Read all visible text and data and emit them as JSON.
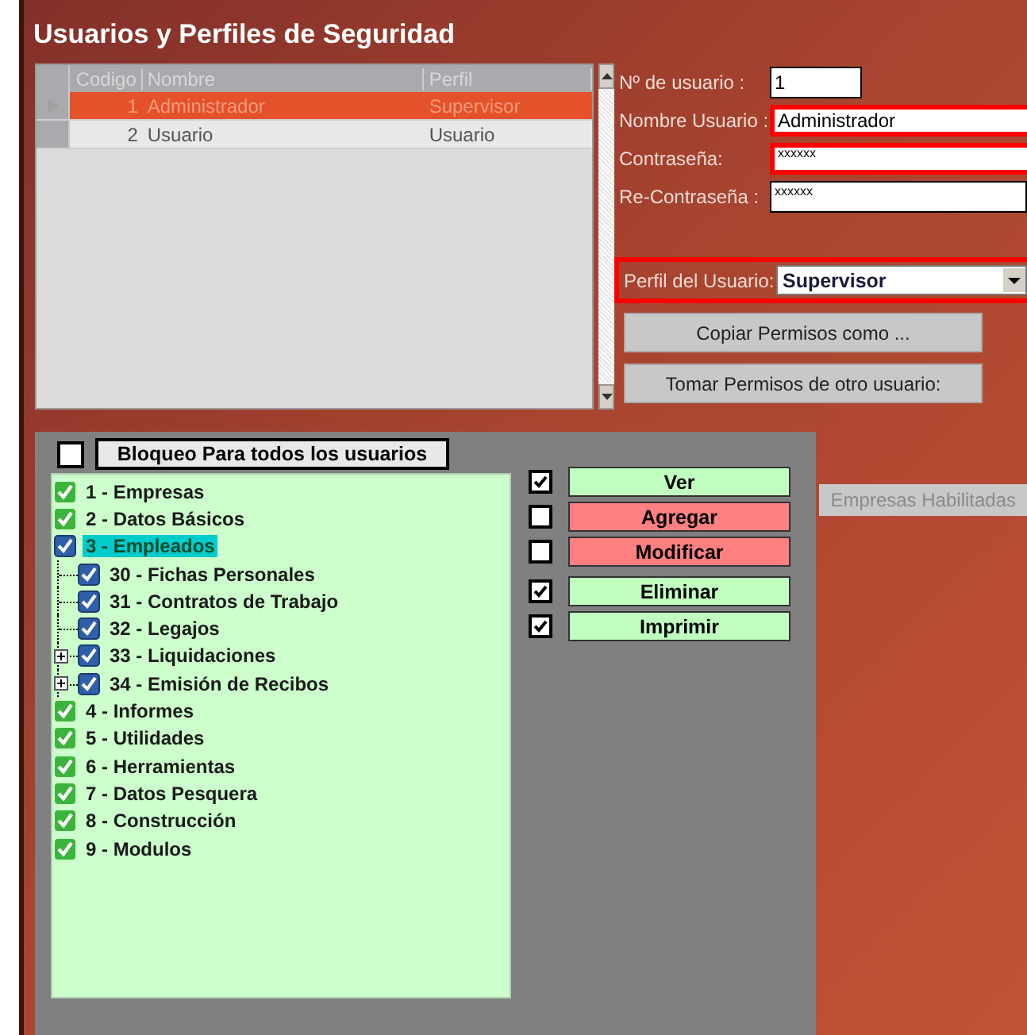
{
  "window": {
    "title": "Usuarios y Perfiles de Seguridad"
  },
  "users_table": {
    "columns": [
      "Codigo",
      "Nombre",
      "Perfil"
    ],
    "rows": [
      {
        "cells": [
          "1",
          "Administrador",
          "Supervisor"
        ],
        "selected": true
      },
      {
        "cells": [
          "2",
          "Usuario",
          "Usuario"
        ],
        "selected": false
      }
    ]
  },
  "fields": [
    {
      "label": "Nº de usuario :",
      "value": "1",
      "kind": "short",
      "highlighted": false
    },
    {
      "label": "Nombre Usuario :",
      "value": "Administrador",
      "kind": "text",
      "highlighted": true
    },
    {
      "label": "Contraseña:",
      "value": "xxxxxx",
      "kind": "password",
      "highlighted": true
    },
    {
      "label": "Re-Contraseña :",
      "value": "xxxxxx",
      "kind": "password",
      "highlighted": false
    }
  ],
  "profile": {
    "label": "Perfil del Usuario:",
    "value": "Supervisor",
    "highlighted": true
  },
  "action_buttons": [
    "Copiar Permisos como ...",
    "Tomar Permisos de otro usuario:"
  ],
  "block_all": {
    "label": "Bloqueo Para todos los usuarios",
    "checked": false
  },
  "tree": [
    {
      "label": "1 - Empresas",
      "checked": true,
      "selected": false
    },
    {
      "label": "2 - Datos Básicos",
      "checked": true,
      "selected": false
    },
    {
      "label": "3 - Empleados",
      "checked": true,
      "selected": true,
      "children": [
        {
          "label": "30 - Fichas Personales",
          "checked": true,
          "selected": false,
          "collapsed": false
        },
        {
          "label": "31 - Contratos de Trabajo",
          "checked": true,
          "selected": false,
          "collapsed": false
        },
        {
          "label": "32 - Legajos",
          "checked": true,
          "selected": false,
          "collapsed": false
        },
        {
          "label": "33 - Liquidaciones",
          "checked": true,
          "selected": false,
          "collapsed": true
        },
        {
          "label": "34 - Emisión de Recibos",
          "checked": true,
          "selected": false,
          "collapsed": true
        }
      ]
    },
    {
      "label": "4 - Informes",
      "checked": true,
      "selected": false
    },
    {
      "label": "5 - Utilidades",
      "checked": true,
      "selected": false
    },
    {
      "label": "6 - Herramientas",
      "checked": true,
      "selected": false
    },
    {
      "label": "7 - Datos Pesquera",
      "checked": true,
      "selected": false
    },
    {
      "label": "8 - Construcción",
      "checked": true,
      "selected": false
    },
    {
      "label": "9 - Modulos",
      "checked": true,
      "selected": false
    }
  ],
  "permissions": [
    {
      "label": "Ver",
      "checked": true
    },
    {
      "label": "Agregar",
      "checked": false
    },
    {
      "label": "Modificar",
      "checked": false
    },
    {
      "label": "Eliminar",
      "checked": true
    },
    {
      "label": "Imprimir",
      "checked": true
    }
  ],
  "side_tab": {
    "label": "Empresas Habilitadas"
  }
}
